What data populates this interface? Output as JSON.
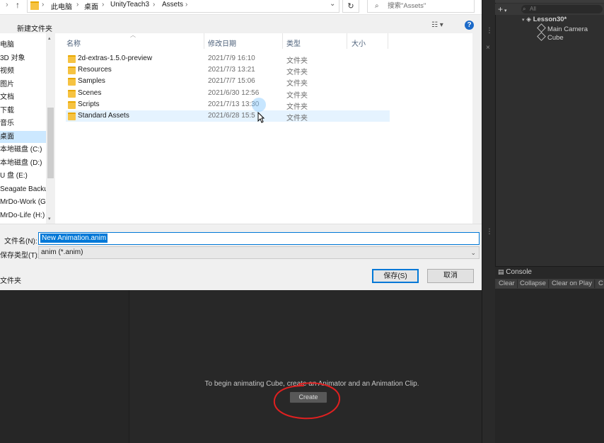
{
  "dialog": {
    "breadcrumb": [
      "此电脑",
      "桌面",
      "UnityTeach3",
      "Assets"
    ],
    "search_placeholder": "搜索\"Assets\"",
    "new_folder": "新建文件夹",
    "help": "?",
    "view_icon": "view-options-icon",
    "nav_items": [
      {
        "label": "电脑"
      },
      {
        "label": "3D 对象"
      },
      {
        "label": "视频"
      },
      {
        "label": "图片"
      },
      {
        "label": "文档"
      },
      {
        "label": "下载"
      },
      {
        "label": "音乐"
      },
      {
        "label": "桌面",
        "selected": true
      },
      {
        "label": "本地磁盘 (C:)"
      },
      {
        "label": "本地磁盘 (D:)"
      },
      {
        "label": "U 盘 (E:)"
      },
      {
        "label": "Seagate Backu"
      },
      {
        "label": "MrDo-Work (G"
      },
      {
        "label": "MrDo-Life (H:)"
      }
    ],
    "columns": {
      "name": "名称",
      "date": "修改日期",
      "type": "类型",
      "size": "大小"
    },
    "files": [
      {
        "name": "2d-extras-1.5.0-preview",
        "date": "2021/7/9 16:10",
        "type": "文件夹"
      },
      {
        "name": "Resources",
        "date": "2021/7/3 13:21",
        "type": "文件夹"
      },
      {
        "name": "Samples",
        "date": "2021/7/7 15:06",
        "type": "文件夹"
      },
      {
        "name": "Scenes",
        "date": "2021/6/30 12:56",
        "type": "文件夹"
      },
      {
        "name": "Scripts",
        "date": "2021/7/13 13:30",
        "type": "文件夹"
      },
      {
        "name": "Standard Assets",
        "date": "2021/6/28 15:5",
        "type": "文件夹"
      }
    ],
    "filename_label": "文件名(N):",
    "filename_value": "New Animation.anim",
    "filetype_label": "保存类型(T):",
    "filetype_value": "anim (*.anim)",
    "hide_folders": "文件夹",
    "save_button": "保存(S)",
    "cancel_button": "取消"
  },
  "unity": {
    "hierarchy": {
      "search_placeholder": "All",
      "plus": "+",
      "scene": "Lesson30*",
      "items": [
        "Main Camera",
        "Cube"
      ]
    },
    "console": {
      "tab": "Console",
      "buttons": [
        "Clear",
        "Collapse",
        "Clear on Play",
        "C"
      ]
    },
    "animation": {
      "message": "To begin animating Cube, create an Animator and an Animation Clip.",
      "create_button": "Create"
    },
    "annotation_color": "#e02020"
  }
}
